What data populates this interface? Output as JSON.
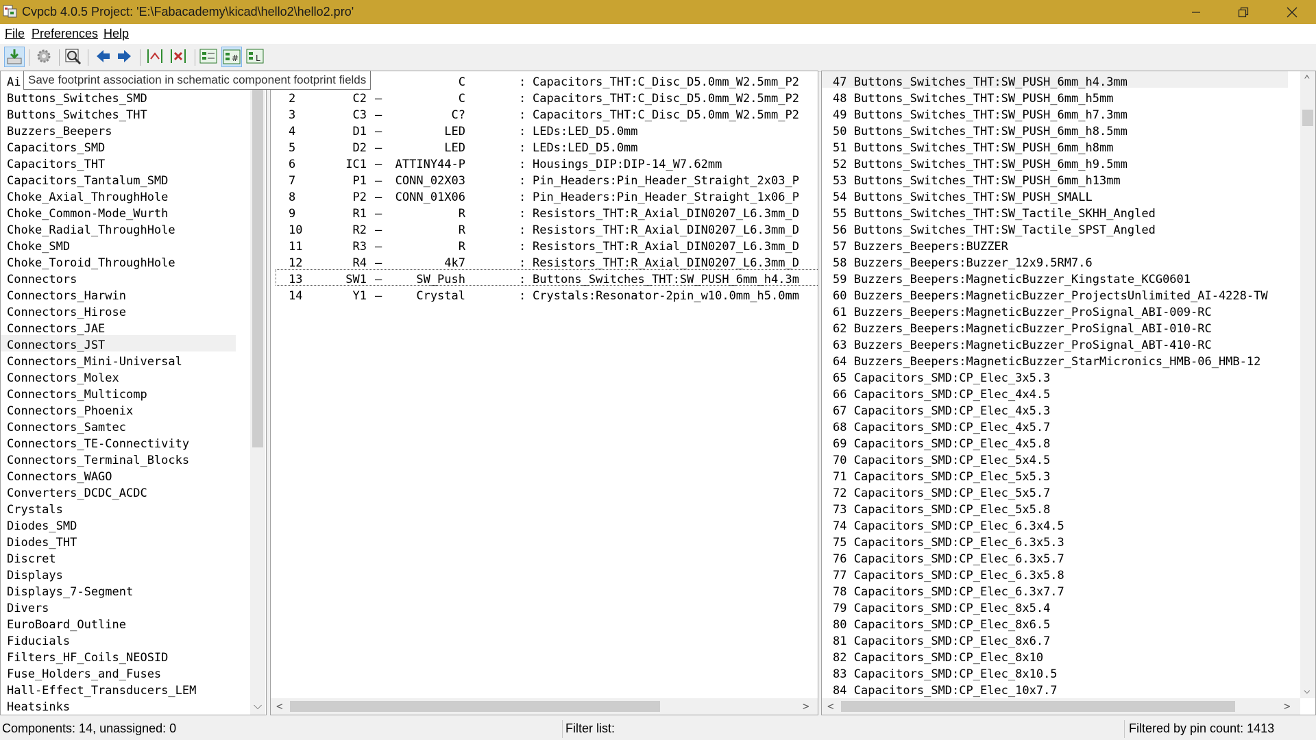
{
  "window": {
    "title": "Cvpcb 4.0.5  Project: 'E:\\Fabacademy\\kicad\\hello2\\hello2.pro'",
    "titlebar_color": "#c9a331"
  },
  "menu": {
    "file": "File",
    "preferences": "Preferences",
    "help": "Help"
  },
  "toolbar": {
    "icons": [
      "save-association-icon",
      "settings-icon",
      "view-footprint-icon",
      "previous-icon",
      "next-icon",
      "auto-associate-icon",
      "delete-associations-icon",
      "filter-keyword-icon",
      "filter-pin-count-icon",
      "filter-library-icon"
    ]
  },
  "tooltip": "Save footprint association in schematic component footprint fields",
  "libraries": [
    "Ai",
    "Buttons_Switches_SMD",
    "Buttons_Switches_THT",
    "Buzzers_Beepers",
    "Capacitors_SMD",
    "Capacitors_THT",
    "Capacitors_Tantalum_SMD",
    "Choke_Axial_ThroughHole",
    "Choke_Common-Mode_Wurth",
    "Choke_Radial_ThroughHole",
    "Choke_SMD",
    "Choke_Toroid_ThroughHole",
    "Connectors",
    "Connectors_Harwin",
    "Connectors_Hirose",
    "Connectors_JAE",
    "Connectors_JST",
    "Connectors_Mini-Universal",
    "Connectors_Molex",
    "Connectors_Multicomp",
    "Connectors_Phoenix",
    "Connectors_Samtec",
    "Connectors_TE-Connectivity",
    "Connectors_Terminal_Blocks",
    "Connectors_WAGO",
    "Converters_DCDC_ACDC",
    "Crystals",
    "Diodes_SMD",
    "Diodes_THT",
    "Discret",
    "Displays",
    "Displays_7-Segment",
    "Divers",
    "EuroBoard_Outline",
    "Fiducials",
    "Filters_HF_Coils_NEOSID",
    "Fuse_Holders_and_Fuses",
    "Hall-Effect_Transducers_LEM",
    "Heatsinks"
  ],
  "components": [
    {
      "num": "",
      "ref": "",
      "value": "C",
      "footprint": "Capacitors_THT:C_Disc_D5.0mm_W2.5mm_P2"
    },
    {
      "num": "2",
      "ref": "C2",
      "value": "C",
      "footprint": "Capacitors_THT:C_Disc_D5.0mm_W2.5mm_P2"
    },
    {
      "num": "3",
      "ref": "C3",
      "value": "C?",
      "footprint": "Capacitors_THT:C_Disc_D5.0mm_W2.5mm_P2"
    },
    {
      "num": "4",
      "ref": "D1",
      "value": "LED",
      "footprint": "LEDs:LED_D5.0mm"
    },
    {
      "num": "5",
      "ref": "D2",
      "value": "LED",
      "footprint": "LEDs:LED_D5.0mm"
    },
    {
      "num": "6",
      "ref": "IC1",
      "value": "ATTINY44-P",
      "footprint": "Housings_DIP:DIP-14_W7.62mm"
    },
    {
      "num": "7",
      "ref": "P1",
      "value": "CONN_02X03",
      "footprint": "Pin_Headers:Pin_Header_Straight_2x03_P"
    },
    {
      "num": "8",
      "ref": "P2",
      "value": "CONN_01X06",
      "footprint": "Pin_Headers:Pin_Header_Straight_1x06_P"
    },
    {
      "num": "9",
      "ref": "R1",
      "value": "R",
      "footprint": "Resistors_THT:R_Axial_DIN0207_L6.3mm_D"
    },
    {
      "num": "10",
      "ref": "R2",
      "value": "R",
      "footprint": "Resistors_THT:R_Axial_DIN0207_L6.3mm_D"
    },
    {
      "num": "11",
      "ref": "R3",
      "value": "R",
      "footprint": "Resistors_THT:R_Axial_DIN0207_L6.3mm_D"
    },
    {
      "num": "12",
      "ref": "R4",
      "value": "4k7",
      "footprint": "Resistors_THT:R_Axial_DIN0207_L6.3mm_D"
    },
    {
      "num": "13",
      "ref": "SW1",
      "value": "SW_Push",
      "footprint": "Buttons_Switches_THT:SW_PUSH_6mm_h4.3m"
    },
    {
      "num": "14",
      "ref": "Y1",
      "value": "Crystal",
      "footprint": "Crystals:Resonator-2pin_w10.0mm_h5.0mm"
    }
  ],
  "footprints": [
    {
      "num": "47",
      "name": "Buttons_Switches_THT:SW_PUSH_6mm_h4.3mm"
    },
    {
      "num": "48",
      "name": "Buttons_Switches_THT:SW_PUSH_6mm_h5mm"
    },
    {
      "num": "49",
      "name": "Buttons_Switches_THT:SW_PUSH_6mm_h7.3mm"
    },
    {
      "num": "50",
      "name": "Buttons_Switches_THT:SW_PUSH_6mm_h8.5mm"
    },
    {
      "num": "51",
      "name": "Buttons_Switches_THT:SW_PUSH_6mm_h8mm"
    },
    {
      "num": "52",
      "name": "Buttons_Switches_THT:SW_PUSH_6mm_h9.5mm"
    },
    {
      "num": "53",
      "name": "Buttons_Switches_THT:SW_PUSH_6mm_h13mm"
    },
    {
      "num": "54",
      "name": "Buttons_Switches_THT:SW_PUSH_SMALL"
    },
    {
      "num": "55",
      "name": "Buttons_Switches_THT:SW_Tactile_SKHH_Angled"
    },
    {
      "num": "56",
      "name": "Buttons_Switches_THT:SW_Tactile_SPST_Angled"
    },
    {
      "num": "57",
      "name": "Buzzers_Beepers:BUZZER"
    },
    {
      "num": "58",
      "name": "Buzzers_Beepers:Buzzer_12x9.5RM7.6"
    },
    {
      "num": "59",
      "name": "Buzzers_Beepers:MagneticBuzzer_Kingstate_KCG0601"
    },
    {
      "num": "60",
      "name": "Buzzers_Beepers:MagneticBuzzer_ProjectsUnlimited_AI-4228-TW"
    },
    {
      "num": "61",
      "name": "Buzzers_Beepers:MagneticBuzzer_ProSignal_ABI-009-RC"
    },
    {
      "num": "62",
      "name": "Buzzers_Beepers:MagneticBuzzer_ProSignal_ABI-010-RC"
    },
    {
      "num": "63",
      "name": "Buzzers_Beepers:MagneticBuzzer_ProSignal_ABT-410-RC"
    },
    {
      "num": "64",
      "name": "Buzzers_Beepers:MagneticBuzzer_StarMicronics_HMB-06_HMB-12"
    },
    {
      "num": "65",
      "name": "Capacitors_SMD:CP_Elec_3x5.3"
    },
    {
      "num": "66",
      "name": "Capacitors_SMD:CP_Elec_4x4.5"
    },
    {
      "num": "67",
      "name": "Capacitors_SMD:CP_Elec_4x5.3"
    },
    {
      "num": "68",
      "name": "Capacitors_SMD:CP_Elec_4x5.7"
    },
    {
      "num": "69",
      "name": "Capacitors_SMD:CP_Elec_4x5.8"
    },
    {
      "num": "70",
      "name": "Capacitors_SMD:CP_Elec_5x4.5"
    },
    {
      "num": "71",
      "name": "Capacitors_SMD:CP_Elec_5x5.3"
    },
    {
      "num": "72",
      "name": "Capacitors_SMD:CP_Elec_5x5.7"
    },
    {
      "num": "73",
      "name": "Capacitors_SMD:CP_Elec_5x5.8"
    },
    {
      "num": "74",
      "name": "Capacitors_SMD:CP_Elec_6.3x4.5"
    },
    {
      "num": "75",
      "name": "Capacitors_SMD:CP_Elec_6.3x5.3"
    },
    {
      "num": "76",
      "name": "Capacitors_SMD:CP_Elec_6.3x5.7"
    },
    {
      "num": "77",
      "name": "Capacitors_SMD:CP_Elec_6.3x5.8"
    },
    {
      "num": "78",
      "name": "Capacitors_SMD:CP_Elec_6.3x7.7"
    },
    {
      "num": "79",
      "name": "Capacitors_SMD:CP_Elec_8x5.4"
    },
    {
      "num": "80",
      "name": "Capacitors_SMD:CP_Elec_8x6.5"
    },
    {
      "num": "81",
      "name": "Capacitors_SMD:CP_Elec_8x6.7"
    },
    {
      "num": "82",
      "name": "Capacitors_SMD:CP_Elec_8x10"
    },
    {
      "num": "83",
      "name": "Capacitors_SMD:CP_Elec_8x10.5"
    },
    {
      "num": "84",
      "name": "Capacitors_SMD:CP_Elec_10x7.7"
    }
  ],
  "status": {
    "components": "Components: 14, unassigned: 0",
    "filter": "Filter list:",
    "filtered": "Filtered by pin count: 1413"
  }
}
